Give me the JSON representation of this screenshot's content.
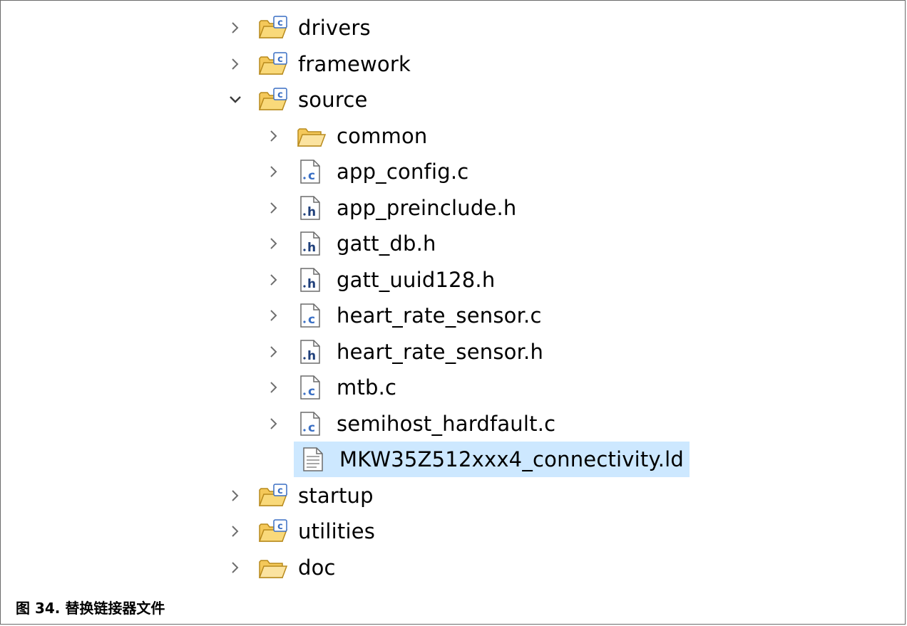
{
  "tree": [
    {
      "label": "drivers",
      "depth": 0,
      "arrow": "collapsed",
      "icon": "source-folder-icon"
    },
    {
      "label": "framework",
      "depth": 0,
      "arrow": "collapsed",
      "icon": "source-folder-icon"
    },
    {
      "label": "source",
      "depth": 0,
      "arrow": "expanded",
      "icon": "source-folder-icon"
    },
    {
      "label": "common",
      "depth": 1,
      "arrow": "collapsed",
      "icon": "folder-icon"
    },
    {
      "label": "app_config.c",
      "depth": 1,
      "arrow": "collapsed",
      "icon": "c-file-icon"
    },
    {
      "label": "app_preinclude.h",
      "depth": 1,
      "arrow": "collapsed",
      "icon": "h-file-icon"
    },
    {
      "label": "gatt_db.h",
      "depth": 1,
      "arrow": "collapsed",
      "icon": "h-file-icon"
    },
    {
      "label": "gatt_uuid128.h",
      "depth": 1,
      "arrow": "collapsed",
      "icon": "h-file-icon"
    },
    {
      "label": "heart_rate_sensor.c",
      "depth": 1,
      "arrow": "collapsed",
      "icon": "c-file-icon"
    },
    {
      "label": "heart_rate_sensor.h",
      "depth": 1,
      "arrow": "collapsed",
      "icon": "h-file-icon"
    },
    {
      "label": "mtb.c",
      "depth": 1,
      "arrow": "collapsed",
      "icon": "c-file-icon"
    },
    {
      "label": "semihost_hardfault.c",
      "depth": 1,
      "arrow": "collapsed",
      "icon": "c-file-icon"
    },
    {
      "label": "MKW35Z512xxx4_connectivity.ld",
      "depth": 1,
      "arrow": "none",
      "icon": "text-file-icon",
      "selected": true
    },
    {
      "label": "startup",
      "depth": 0,
      "arrow": "collapsed",
      "icon": "source-folder-icon"
    },
    {
      "label": "utilities",
      "depth": 0,
      "arrow": "collapsed",
      "icon": "source-folder-icon"
    },
    {
      "label": "doc",
      "depth": 0,
      "arrow": "collapsed",
      "icon": "folder-icon"
    }
  ],
  "caption": "图 34. 替换链接器文件",
  "colors": {
    "selection": "#cde8ff",
    "folder": "#f4c85a",
    "folder_stroke": "#b88a1c",
    "c_badge": "#3a6fc4",
    "arrow": "#6e6e6e"
  }
}
